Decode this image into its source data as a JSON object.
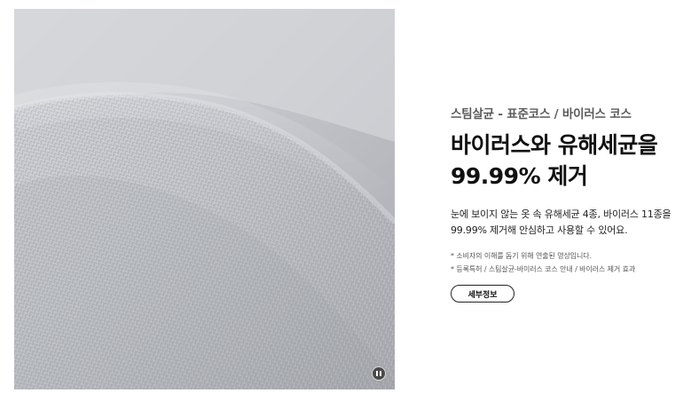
{
  "media": {
    "description_icon": "knit-fabric-photo",
    "pause_icon": "pause-icon"
  },
  "content": {
    "subtitle": "스팀살균 - 표준코스 / 바이러스 코스",
    "headline_line1": "바이러스와 유해세균을",
    "headline_line2": "99.99% 제거",
    "description_line1": "눈에 보이지 않는 옷 속 유해세균 4종, 바이러스 11종을",
    "description_line2": "99.99% 제거해 안심하고 사용할 수 있어요.",
    "notes": [
      "* 소비자의 이해를 돕기 위해 연출된 영상입니다.",
      "* 등록특허 / 스팀살균-바이러스 코스 안내 / 바이러스 제거 효과"
    ],
    "detail_button": "세부정보"
  }
}
